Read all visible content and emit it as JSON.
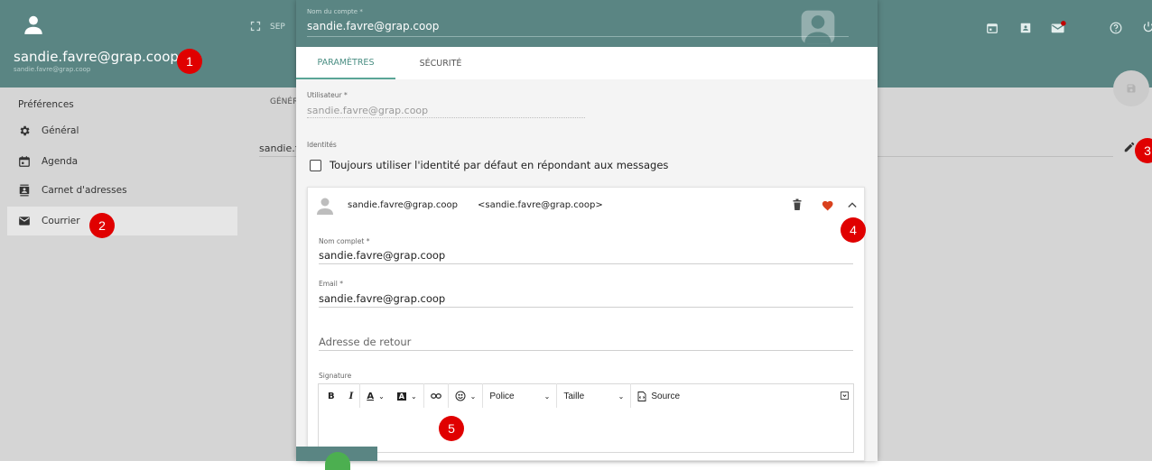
{
  "sidebar": {
    "user_name": "sandie.favre@grap.coop",
    "user_email": "sandie.favre@grap.coop",
    "section_title": "Préférences",
    "items": [
      {
        "label": "Général",
        "icon": "gear-icon"
      },
      {
        "label": "Agenda",
        "icon": "calendar-icon"
      },
      {
        "label": "Carnet d'adresses",
        "icon": "contacts-icon"
      },
      {
        "label": "Courrier",
        "icon": "mail-icon",
        "active": true
      }
    ]
  },
  "background": {
    "topbar_text": "SEP",
    "tab_text": "GÉNÉR",
    "row_text": "sandie.f"
  },
  "dialog": {
    "account_label": "Nom du compte *",
    "account_value": "sandie.favre@grap.coop",
    "tabs": [
      "PARAMÈTRES",
      "SÉCURITÉ"
    ],
    "user_label": "Utilisateur *",
    "user_value": "sandie.favre@grap.coop",
    "identities_label": "Identités",
    "default_identity_checkbox": "Toujours utiliser l'identité par défaut en répondant aux messages",
    "identity": {
      "header_name": "sandie.favre@grap.coop",
      "header_email": "<sandie.favre@grap.coop>",
      "fullname_label": "Nom complet *",
      "fullname_value": "sandie.favre@grap.coop",
      "email_label": "Email *",
      "email_value": "sandie.favre@grap.coop",
      "reply_placeholder": "Adresse de retour",
      "signature_label": "Signature"
    },
    "editor_toolbar": {
      "bold": "B",
      "italic": "I",
      "text_color": "A",
      "bg_color": "A",
      "font_select": "Police",
      "size_select": "Taille",
      "source": "Source"
    }
  },
  "markers": [
    "1",
    "2",
    "3",
    "4",
    "5"
  ],
  "colors": {
    "brand": "#5a8583",
    "marker": "#e00000",
    "heart": "#d9411e",
    "tab_active": "#4b8f84"
  }
}
